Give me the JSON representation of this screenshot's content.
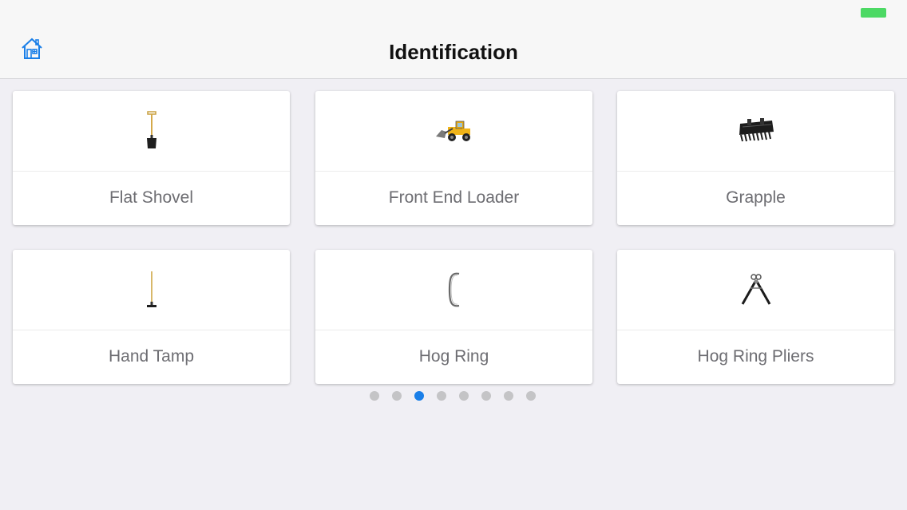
{
  "header": {
    "title": "Identification",
    "home_icon": "home-icon"
  },
  "colors": {
    "accent": "#1a7fe8",
    "battery": "#4cd964",
    "page_background": "#f0eff4"
  },
  "items": [
    {
      "label": "Flat Shovel",
      "icon": "flat-shovel-icon"
    },
    {
      "label": "Front End Loader",
      "icon": "front-end-loader-icon"
    },
    {
      "label": "Grapple",
      "icon": "grapple-icon"
    },
    {
      "label": "Hand Tamp",
      "icon": "hand-tamp-icon"
    },
    {
      "label": "Hog Ring",
      "icon": "hog-ring-icon"
    },
    {
      "label": "Hog Ring Pliers",
      "icon": "hog-ring-pliers-icon"
    }
  ],
  "pagination": {
    "page_count": 8,
    "current_page": 3
  }
}
